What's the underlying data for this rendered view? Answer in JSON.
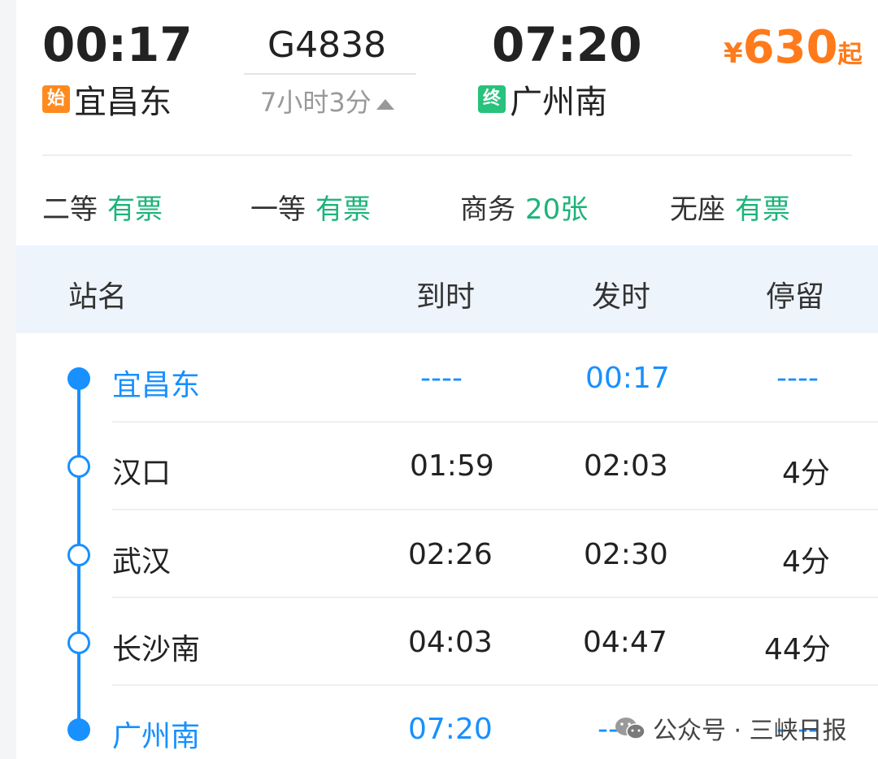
{
  "trip": {
    "depart_time": "00:17",
    "train_number": "G4838",
    "arrive_time": "07:20",
    "duration": "7小时3分",
    "start_badge": "始",
    "start_station": "宜昌东",
    "end_badge": "终",
    "end_station": "广州南",
    "price": {
      "currency": "¥",
      "amount": "630",
      "suffix": "起",
      "color": "#ff7a1a"
    }
  },
  "seats": [
    {
      "class": "二等",
      "availability": "有票"
    },
    {
      "class": "一等",
      "availability": "有票"
    },
    {
      "class": "商务",
      "availability": "20张"
    },
    {
      "class": "无座",
      "availability": "有票"
    }
  ],
  "table": {
    "headers": {
      "station": "站名",
      "arrive": "到时",
      "depart": "发时",
      "stop": "停留"
    },
    "rows": [
      {
        "station": "宜昌东",
        "arrive": "----",
        "depart": "00:17",
        "stop": "----"
      },
      {
        "station": "汉口",
        "arrive": "01:59",
        "depart": "02:03",
        "stop": "4分"
      },
      {
        "station": "武汉",
        "arrive": "02:26",
        "depart": "02:30",
        "stop": "4分"
      },
      {
        "station": "长沙南",
        "arrive": "04:03",
        "depart": "04:47",
        "stop": "44分"
      },
      {
        "station": "广州南",
        "arrive": "07:20",
        "depart": "----",
        "stop": "----"
      }
    ]
  },
  "watermark": {
    "text": "公众号 · 三峡日报",
    "icon": "wechat-icon"
  },
  "colors": {
    "accent_blue": "#1890ff",
    "available_green": "#1db37a",
    "start_badge": "#ff8a1f",
    "end_badge": "#27c27c"
  }
}
